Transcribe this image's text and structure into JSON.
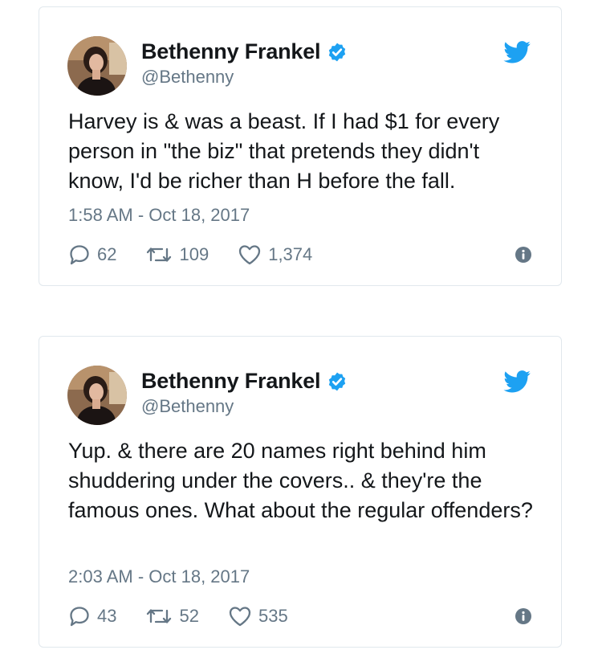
{
  "colors": {
    "twitter_blue": "#1da1f2",
    "text_primary": "#14171a",
    "text_secondary": "#657786",
    "border": "#e1e8ed"
  },
  "icons": {
    "reply": "reply-icon",
    "retweet": "retweet-icon",
    "like": "heart-icon",
    "info": "info-icon",
    "brand": "twitter-bird-icon",
    "verified": "verified-badge-icon"
  },
  "tweets": [
    {
      "author": {
        "name": "Bethenny Frankel",
        "handle": "@Bethenny",
        "verified": true
      },
      "text": "Harvey is & was a beast. If I had $1 for every person in \"the biz\" that pretends they didn't know, I'd be richer than H before the fall.",
      "timestamp": "1:58 AM - Oct 18, 2017",
      "replies": "62",
      "retweets": "109",
      "likes": "1,374"
    },
    {
      "author": {
        "name": "Bethenny Frankel",
        "handle": "@Bethenny",
        "verified": true
      },
      "text": "Yup. & there are 20 names right behind him shuddering under the covers.. & they're the famous ones. What about the regular offenders?",
      "timestamp": "2:03 AM - Oct 18, 2017",
      "replies": "43",
      "retweets": "52",
      "likes": "535"
    }
  ]
}
